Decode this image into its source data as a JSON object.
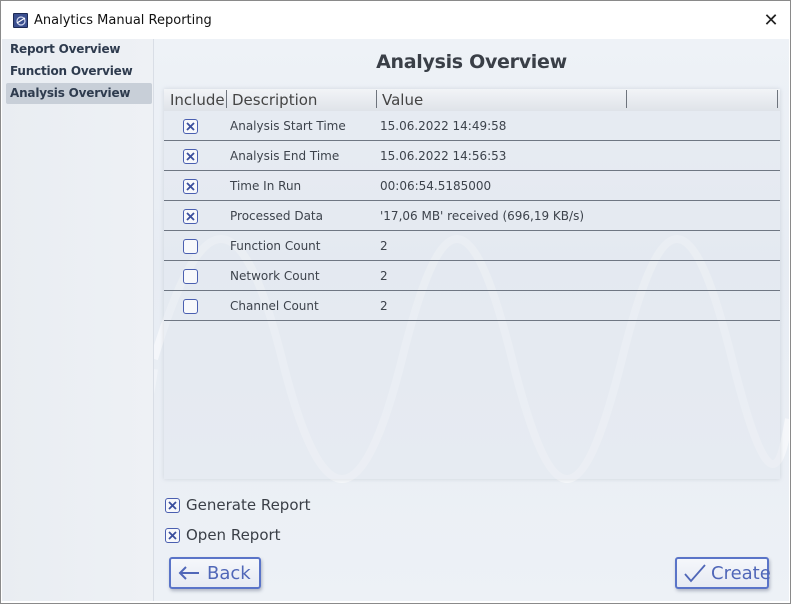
{
  "window": {
    "title": "Analytics Manual Reporting",
    "close_glyph": "✕"
  },
  "sidebar": {
    "items": [
      {
        "label": "Report Overview",
        "active": false
      },
      {
        "label": "Function Overview",
        "active": false
      },
      {
        "label": "Analysis Overview",
        "active": true
      }
    ]
  },
  "main": {
    "title": "Analysis Overview",
    "columns": [
      "Include",
      "Description",
      "Value"
    ],
    "rows": [
      {
        "include": true,
        "description": "Analysis Start Time",
        "value": "15.06.2022 14:49:58"
      },
      {
        "include": true,
        "description": "Analysis End Time",
        "value": "15.06.2022 14:56:53"
      },
      {
        "include": true,
        "description": "Time In Run",
        "value": "00:06:54.5185000"
      },
      {
        "include": true,
        "description": "Processed Data",
        "value": "'17,06 MB' received (696,19 KB/s)"
      },
      {
        "include": false,
        "description": "Function Count",
        "value": "2"
      },
      {
        "include": false,
        "description": "Network Count",
        "value": "2"
      },
      {
        "include": false,
        "description": "Channel Count",
        "value": "2"
      }
    ],
    "generate_report": {
      "label": "Generate Report",
      "checked": true
    },
    "open_report": {
      "label": "Open Report",
      "checked": true
    }
  },
  "buttons": {
    "back_label": "Back",
    "create_label": "Create"
  },
  "colors": {
    "accent": "#5a74c8",
    "checkbox_border": "#4a5fb0",
    "row_divider": "#6f7783"
  },
  "icons": [
    "app-icon",
    "close-icon",
    "check-x-icon",
    "arrow-left-icon",
    "checkmark-icon"
  ]
}
